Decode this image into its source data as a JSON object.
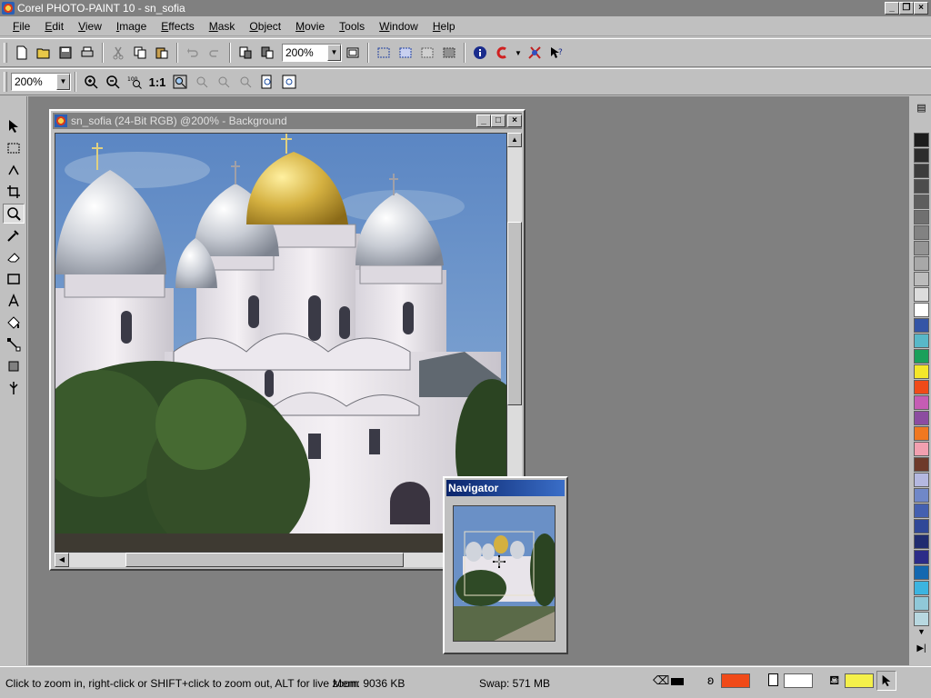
{
  "app": {
    "title": "Corel PHOTO-PAINT 10 - sn_sofia"
  },
  "menu": [
    "File",
    "Edit",
    "View",
    "Image",
    "Effects",
    "Mask",
    "Object",
    "Movie",
    "Tools",
    "Window",
    "Help"
  ],
  "toolbar": {
    "zoom_value": "200%"
  },
  "zoombar": {
    "zoom_value": "200%",
    "actual_size_label": "1:1"
  },
  "document": {
    "title": "sn_sofia (24-Bit RGB) @200% - Background"
  },
  "navigator": {
    "title": "Navigator"
  },
  "palette": {
    "colors": [
      "#1c1c1c",
      "#2c2c2c",
      "#3c3c3c",
      "#4c4c4c",
      "#5e5e5e",
      "#707070",
      "#828282",
      "#949494",
      "#a8a8a8",
      "#bcbcbc",
      "#dcdcdc",
      "#ffffff",
      "#3455a6",
      "#58b8c8",
      "#1aa05a",
      "#f4e62a",
      "#f04a18",
      "#c55cb4",
      "#8c4ca0",
      "#f07820",
      "#f2a0b0",
      "#6e3a2a",
      "#b4b8e0",
      "#7088c8",
      "#4460b0",
      "#304898",
      "#202c70",
      "#2c2c88",
      "#1468b0",
      "#3cb4e0",
      "#90c8d8",
      "#b8d8e0"
    ]
  },
  "status": {
    "hint": "Click to zoom in, right-click or SHIFT+click to zoom out, ALT for live zoom",
    "mem": "Mem: 9036 KB",
    "swap": "Swap: 571 MB",
    "outline_color": "#f04a18",
    "paper_color": "#ffffff",
    "fill_color": "#f4f04a"
  }
}
